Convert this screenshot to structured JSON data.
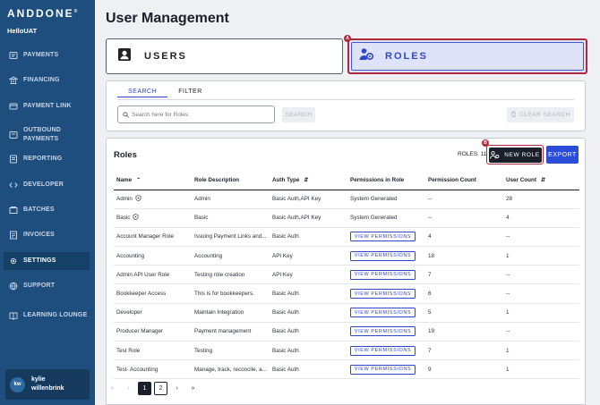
{
  "brand": {
    "logo_text": "ANDDONE",
    "logo_mark": "®",
    "org_name": "HelloUAT"
  },
  "sidebar": {
    "items": [
      {
        "label": "PAYMENTS",
        "icon": "payments-icon"
      },
      {
        "label": "FINANCING",
        "icon": "bank-icon"
      },
      {
        "label": "PAYMENT LINK",
        "icon": "link-card-icon"
      },
      {
        "label": "OUTBOUND PAYMENTS",
        "icon": "outbound-icon"
      },
      {
        "label": "REPORTING",
        "icon": "report-icon"
      },
      {
        "label": "DEVELOPER",
        "icon": "code-icon"
      },
      {
        "label": "BATCHES",
        "icon": "batches-icon"
      },
      {
        "label": "INVOICES",
        "icon": "invoice-icon"
      },
      {
        "label": "SETTINGS",
        "icon": "gear-icon",
        "active": true
      },
      {
        "label": "SUPPORT",
        "icon": "globe-icon"
      },
      {
        "label": "LEARNING LOUNGE",
        "icon": "book-icon"
      }
    ],
    "user": {
      "initials": "kw",
      "name": "kylie willenbrink"
    }
  },
  "page": {
    "title": "User Management"
  },
  "toggle": {
    "users_label": "USERS",
    "roles_label": "ROLES",
    "roles_badge": "A"
  },
  "search": {
    "tab_search": "SEARCH",
    "tab_filter": "FILTER",
    "placeholder": "Search here for Roles",
    "search_button": "SEARCH",
    "clear_button": "CLEAR SEARCH"
  },
  "roles": {
    "title": "Roles",
    "count_label": "ROLES: 11",
    "new_button": "NEW ROLE",
    "new_badge": "B",
    "export_button": "EXPORT",
    "columns": [
      "Name",
      "Role Description",
      "Auth Type",
      "Permissions in Role",
      "Permission Count",
      "User Count"
    ],
    "rows": [
      {
        "name": "Admin",
        "desc": "Admin",
        "auth": "Basic Auth,API Key",
        "perm": "System Generated",
        "perm_count": "--",
        "user_count": "28",
        "shield": true
      },
      {
        "name": "Basic",
        "desc": "Basic",
        "auth": "Basic Auth,API Key",
        "perm": "System Generated",
        "perm_count": "--",
        "user_count": "4",
        "shield": true
      },
      {
        "name": "Account Manager Role",
        "desc": "Issuing Payment Links and...",
        "auth": "Basic Auth",
        "perm": "VIEW PERMISSIONS",
        "perm_count": "4",
        "user_count": "--"
      },
      {
        "name": "Accounting",
        "desc": "Accounting",
        "auth": "API Key",
        "perm": "VIEW PERMISSIONS",
        "perm_count": "18",
        "user_count": "1"
      },
      {
        "name": "Admin API User Role",
        "desc": "Testing role creation",
        "auth": "API Key",
        "perm": "VIEW PERMISSIONS",
        "perm_count": "7",
        "user_count": "--"
      },
      {
        "name": "Bookkeeper Access",
        "desc": "This is for bookkeepers.",
        "auth": "Basic Auth",
        "perm": "VIEW PERMISSIONS",
        "perm_count": "6",
        "user_count": "--"
      },
      {
        "name": "Developer",
        "desc": "Maintain Integration",
        "auth": "Basic Auth",
        "perm": "VIEW PERMISSIONS",
        "perm_count": "5",
        "user_count": "1"
      },
      {
        "name": "Producer Manager",
        "desc": "Payment management",
        "auth": "Basic Auth",
        "perm": "VIEW PERMISSIONS",
        "perm_count": "19",
        "user_count": "--"
      },
      {
        "name": "Test Role",
        "desc": "Testing",
        "auth": "Basic Auth",
        "perm": "VIEW PERMISSIONS",
        "perm_count": "7",
        "user_count": "1"
      },
      {
        "name": "Test- Accounting",
        "desc": "Manage, track, reconcile, a...",
        "auth": "Basic Auth",
        "perm": "VIEW PERMISSIONS",
        "perm_count": "9",
        "user_count": "1"
      }
    ]
  },
  "pagination": {
    "first": "«",
    "prev": "‹",
    "pages": [
      "1",
      "2"
    ],
    "next": "›",
    "last": "»",
    "current": "1"
  },
  "colors": {
    "sidebar": "#1d4e7e",
    "accent": "#2f47c6",
    "highlight": "#b1283a",
    "export": "#2b4cd8"
  }
}
